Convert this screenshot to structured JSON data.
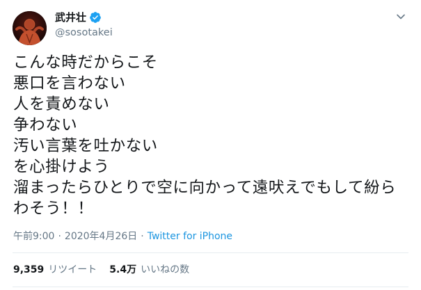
{
  "author": {
    "display_name": "武井壮",
    "handle": "@sosotakei",
    "verified_icon": "verified-badge-icon",
    "accent": "#1da1f2"
  },
  "tweet": {
    "lines": [
      "こんな時だからこそ",
      "悪口を言わない",
      "人を責めない",
      "争わない",
      "汚い言葉を吐かない",
      "を心掛けよう",
      "溜まったらひとりで空に向かって遠吠えでもして紛ら",
      "わそう！！"
    ],
    "time": "午前9:00",
    "separator": "·",
    "date": "2020年4月26日",
    "source": "Twitter for iPhone"
  },
  "stats": {
    "retweets_count": "9,359",
    "retweets_label": "リツイート",
    "likes_count": "5.4万",
    "likes_label": "いいねの数"
  },
  "colors": {
    "text": "#14171a",
    "secondary": "#657786",
    "link": "#1b95e0",
    "divider": "#e6ecf0"
  }
}
